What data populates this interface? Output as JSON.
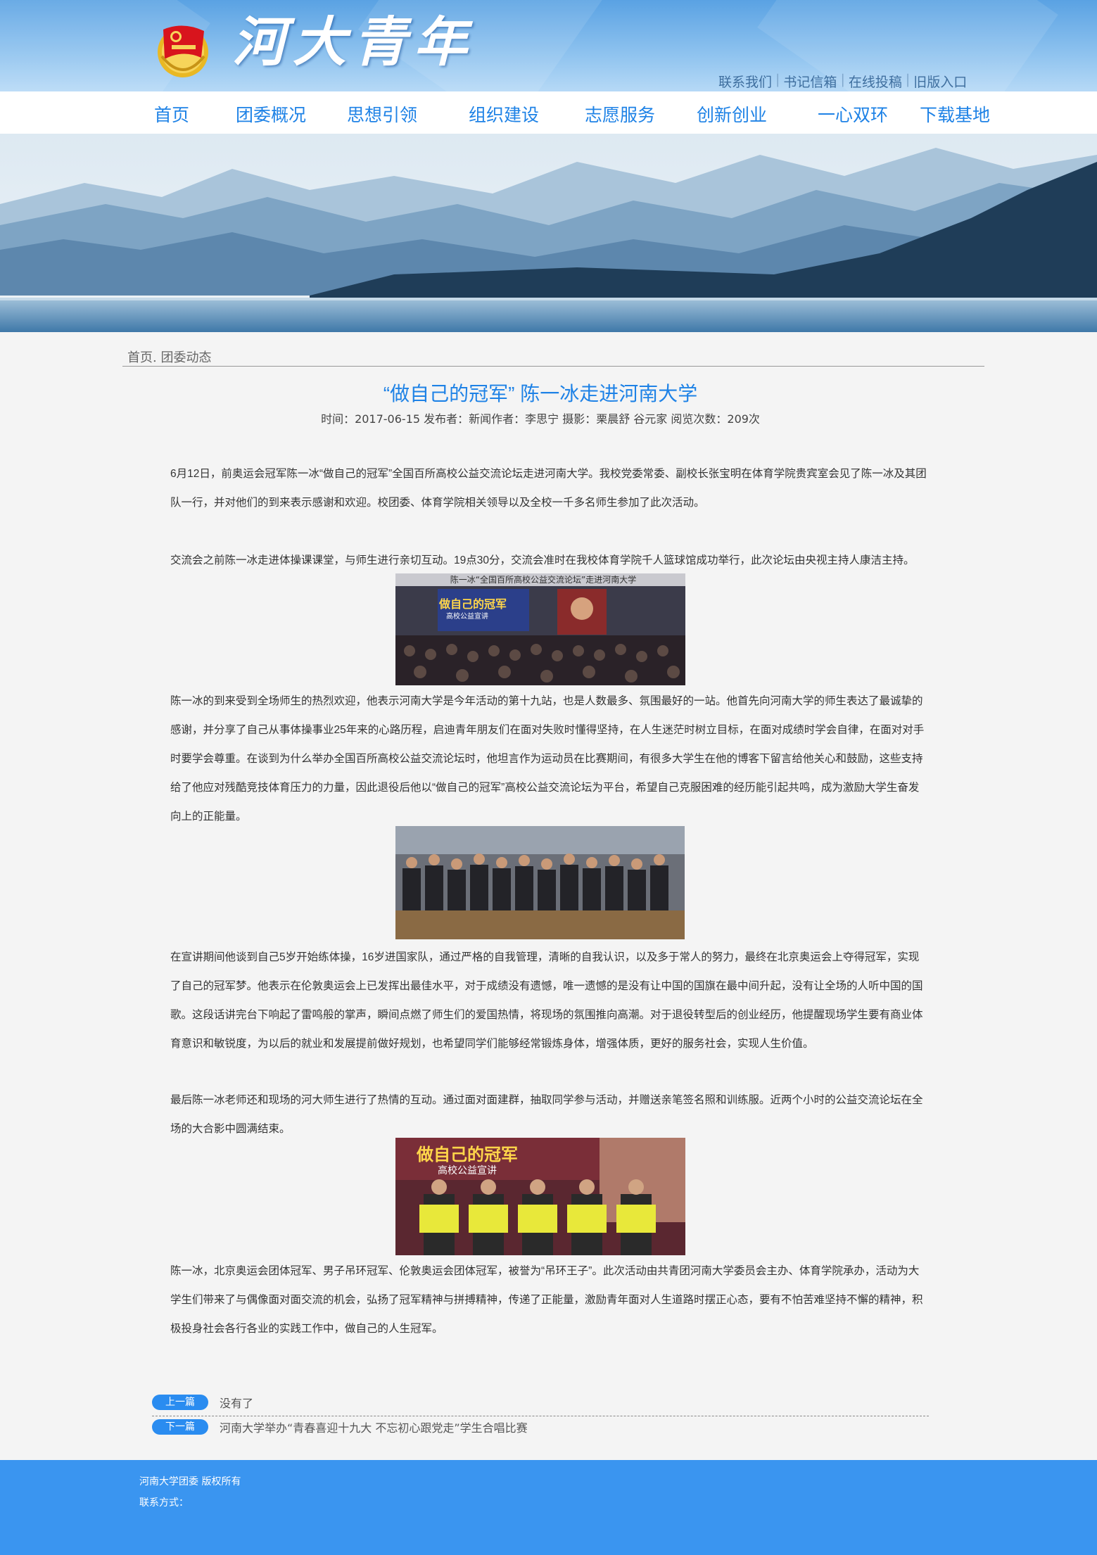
{
  "header": {
    "site_title": "河大青年",
    "top_links": [
      "联系我们",
      "书记信箱",
      "在线投稿",
      "旧版入口"
    ]
  },
  "nav": {
    "items": [
      "首页",
      "团委概况",
      "思想引领",
      "组织建设",
      "志愿服务",
      "创新创业",
      "一心双环",
      "下载基地"
    ]
  },
  "breadcrumb": "首页. 团委动态",
  "article": {
    "title": "“做自己的冠军” 陈一冰走进河南大学",
    "meta": "时间：2017-06-15 发布者：新闻作者：李思宁 摄影：栗晨舒 谷元家 阅览次数：209次",
    "paragraphs": [
      "6月12日，前奥运会冠军陈一冰“做自己的冠军”全国百所高校公益交流论坛走进河南大学。我校党委常委、副校长张宝明在体育学院贵宾室会见了陈一冰及其团队一行，并对他们的到来表示感谢和欢迎。校团委、体育学院相关领导以及全校一千多名师生参加了此次活动。",
      "交流会之前陈一冰走进体操课课堂，与师生进行亲切互动。19点30分，交流会准时在我校体育学院千人篮球馆成功举行，此次论坛由央视主持人康洁主持。",
      "陈一冰的到来受到全场师生的热烈欢迎，他表示河南大学是今年活动的第十九站，也是人数最多、氛围最好的一站。他首先向河南大学的师生表达了最诚挚的感谢，并分享了自己从事体操事业25年来的心路历程，启迪青年朋友们在面对失败时懂得坚持，在人生迷茫时树立目标，在面对成绩时学会自律，在面对对手时要学会尊重。在谈到为什么举办全国百所高校公益交流论坛时，他坦言作为运动员在比赛期间，有很多大学生在他的博客下留言给他关心和鼓励，这些支持给了他应对残酷竞技体育压力的力量，因此退役后他以“做自己的冠军”高校公益交流论坛为平台，希望自己克服困难的经历能引起共鸣，成为激励大学生奋发向上的正能量。",
      "在宣讲期间他谈到自己5岁开始练体操，16岁进国家队，通过严格的自我管理，清晰的自我认识，以及多于常人的努力，最终在北京奥运会上夺得冠军，实现了自己的冠军梦。他表示在伦敦奥运会上已发挥出最佳水平，对于成绩没有遗憾，唯一遗憾的是没有让中国的国旗在最中间升起，没有让全场的人听中国的国歌。这段话讲完台下响起了雷鸣般的掌声，瞬间点燃了师生们的爱国热情，将现场的氛围推向高潮。对于退役转型后的创业经历，他提醒现场学生要有商业体育意识和敏锐度，为以后的就业和发展提前做好规划，也希望同学们能够经常锻炼身体，增强体质，更好的服务社会，实现人生价值。",
      "最后陈一冰老师还和现场的河大师生进行了热情的互动。通过面对面建群，抽取同学参与活动，并赠送亲笔签名照和训练服。近两个小时的公益交流论坛在全场的大合影中圆满结束。",
      "陈一冰，北京奥运会团体冠军、男子吊环冠军、伦敦奥运会团体冠军，被誉为“吊环王子”。此次活动由共青团河南大学委员会主办、体育学院承办，活动为大学生们带来了与偶像面对面交流的机会，弘扬了冠军精神与拼搏精神，传递了正能量，激励青年面对人生道路时摆正心态，要有不怕苦难坚持不懈的精神，积极投身社会各行各业的实践工作中，做自己的人生冠军。"
    ],
    "photo1_banner": "陈一冰“全国百所高校公益交流论坛”走进河南大学",
    "photo1_title": "做自己的冠军",
    "photo1_sub": "高校公益宣讲",
    "photo3_title": "做自己的冠军",
    "photo3_sub": "高校公益宣讲"
  },
  "prev_next": {
    "prev_label": "上一篇",
    "prev_text": "没有了",
    "next_label": "下一篇",
    "next_text": "河南大学举办“青春喜迎十九大 不忘初心跟党走”学生合唱比赛"
  },
  "footer": {
    "copyright": "河南大学团委 版权所有",
    "contact": "联系方式："
  },
  "colors": {
    "accent": "#1e82e6",
    "footer_bg": "#3a95f0",
    "badge": "#2a8cf0"
  }
}
